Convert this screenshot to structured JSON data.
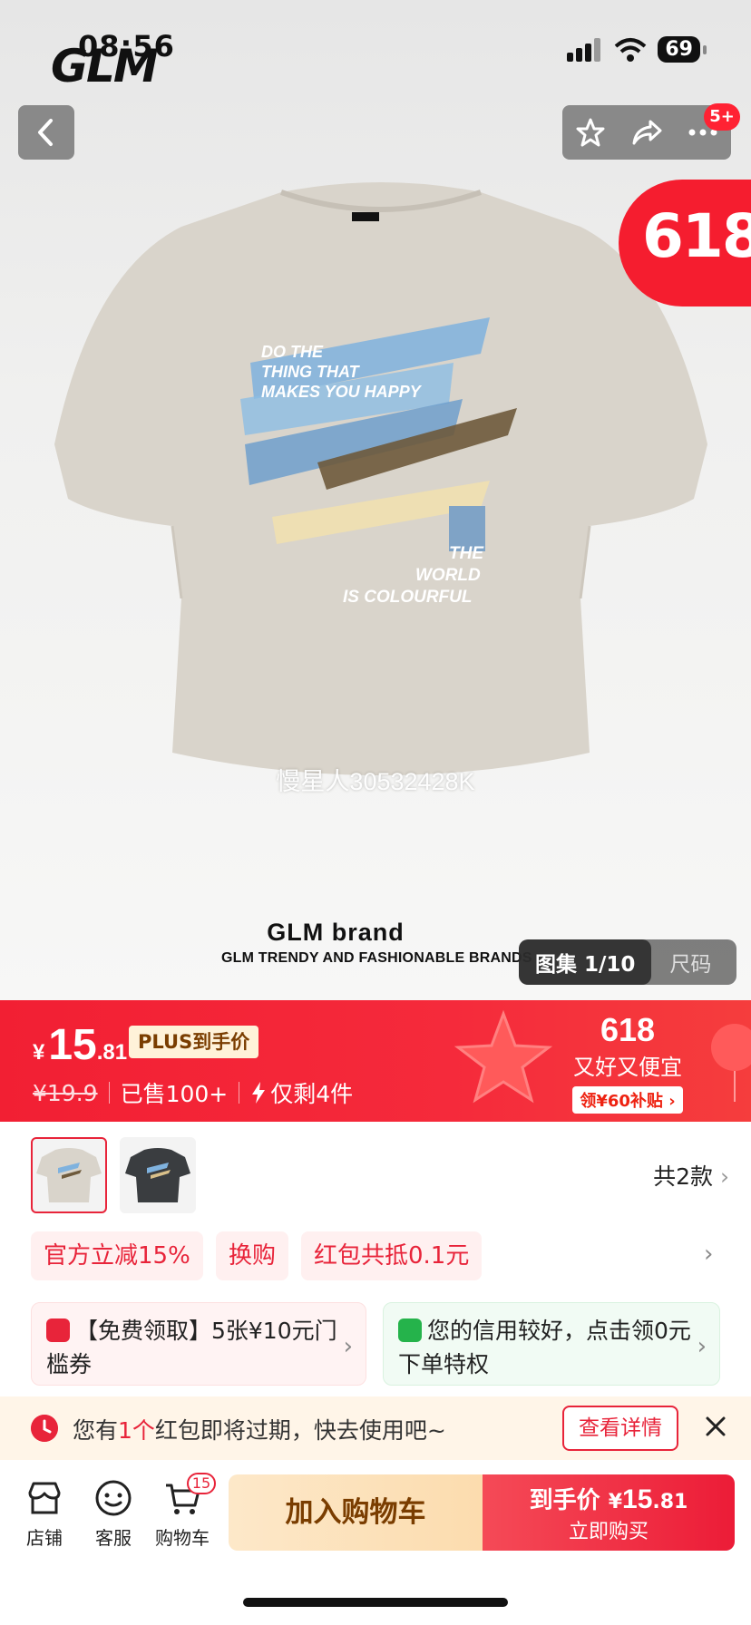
{
  "status": {
    "time": "08:56",
    "battery": "69"
  },
  "brand_logo": "GLM",
  "header": {
    "notification_badge": "5+"
  },
  "promo_badge": "618",
  "product_image": {
    "print_text_top": [
      "DO THE",
      "THING THAT",
      "MAKES YOU HAPPY"
    ],
    "print_text_bottom": [
      "THE",
      "WORLD",
      "IS COLOURFUL"
    ],
    "watermark": "慢星人30532428K",
    "brand_title": "GLM brand",
    "brand_subtitle": "GLM TRENDY AND FASHIONABLE BRANDS",
    "gallery_label": "图集 1/10",
    "size_label": "尺码"
  },
  "price": {
    "currency": "¥",
    "integer": "15",
    "decimal": ".81",
    "plus_tag": "PLUS到手价",
    "original": "¥19.9",
    "sold": "已售100+",
    "stock": "仅剩4件"
  },
  "event": {
    "title": "618",
    "slogan": "又好又便宜",
    "subsidy": "领¥60补贴"
  },
  "sku": {
    "count_label": "共2款"
  },
  "coupons": [
    "官方立减15%",
    "换购",
    "红包共抵0.1元"
  ],
  "cards": {
    "free_coupon": "【免费领取】5张¥10元门槛券",
    "credit": "您的信用较好，点击领0元下单特权"
  },
  "expire": {
    "prefix": "您有",
    "count": "1个",
    "suffix": "红包即将过期，快去使用吧~",
    "button": "查看详情"
  },
  "bottom_nav": {
    "shop": "店铺",
    "service": "客服",
    "cart": "购物车",
    "cart_badge": "15"
  },
  "actions": {
    "add_to_cart": "加入购物车",
    "buy_prefix": "到手价",
    "buy_currency": "¥",
    "buy_integer": "15",
    "buy_decimal": ".81",
    "buy_now": "立即购买"
  },
  "colors": {
    "accent": "#e8243a",
    "band": "#f21f33",
    "cart_button": "#fde8c9"
  }
}
